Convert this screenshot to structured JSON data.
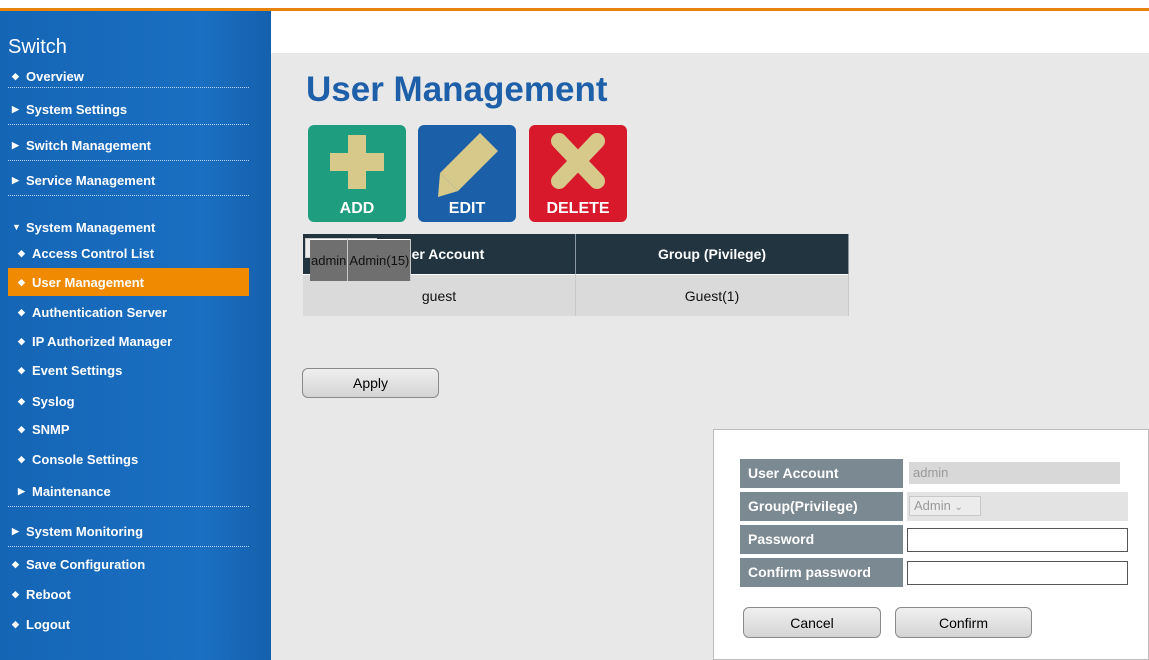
{
  "sidebar": {
    "brand": "Switch",
    "items": [
      {
        "marker": "◆",
        "label": "Overview"
      },
      {
        "marker": "▶",
        "label": "System Settings"
      },
      {
        "marker": "▶",
        "label": "Switch Management"
      },
      {
        "marker": "▶",
        "label": "Service Management"
      },
      {
        "marker": "▼",
        "label": "System Management"
      },
      {
        "marker": "◆",
        "label": "Access Control List"
      },
      {
        "marker": "◆",
        "label": "User Management"
      },
      {
        "marker": "◆",
        "label": "Authentication Server"
      },
      {
        "marker": "◆",
        "label": "IP Authorized Manager"
      },
      {
        "marker": "◆",
        "label": "Event Settings"
      },
      {
        "marker": "◆",
        "label": "Syslog"
      },
      {
        "marker": "◆",
        "label": "SNMP"
      },
      {
        "marker": "◆",
        "label": "Console Settings"
      },
      {
        "marker": "▶",
        "label": "Maintenance"
      },
      {
        "marker": "▶",
        "label": "System Monitoring"
      },
      {
        "marker": "◆",
        "label": "Save Configuration"
      },
      {
        "marker": "◆",
        "label": "Reboot"
      },
      {
        "marker": "◆",
        "label": "Logout"
      }
    ]
  },
  "page": {
    "title": "User Management"
  },
  "toolbar": {
    "add": "ADD",
    "edit": "EDIT",
    "delete": "DELETE"
  },
  "colors": {
    "accent": "#f08a00",
    "title": "#1d5fa8",
    "add": "#1f9d7f",
    "edit": "#1a5fa8",
    "delete": "#d8192c",
    "icon_glyph": "#d6c98a"
  },
  "table": {
    "headers": [
      "User Account",
      "Group (Pivilege)"
    ],
    "rows": [
      {
        "account": "admin",
        "group": "Admin(15)"
      },
      {
        "account": "guest",
        "group": "Guest(1)"
      }
    ]
  },
  "apply_label": "Apply",
  "dialog": {
    "user_account_label": "User Account",
    "user_account_value": "admin",
    "group_label": "Group(Privilege)",
    "group_value": "Admin",
    "password_label": "Password",
    "confirm_label": "Confirm password",
    "cancel": "Cancel",
    "confirm": "Confirm"
  }
}
